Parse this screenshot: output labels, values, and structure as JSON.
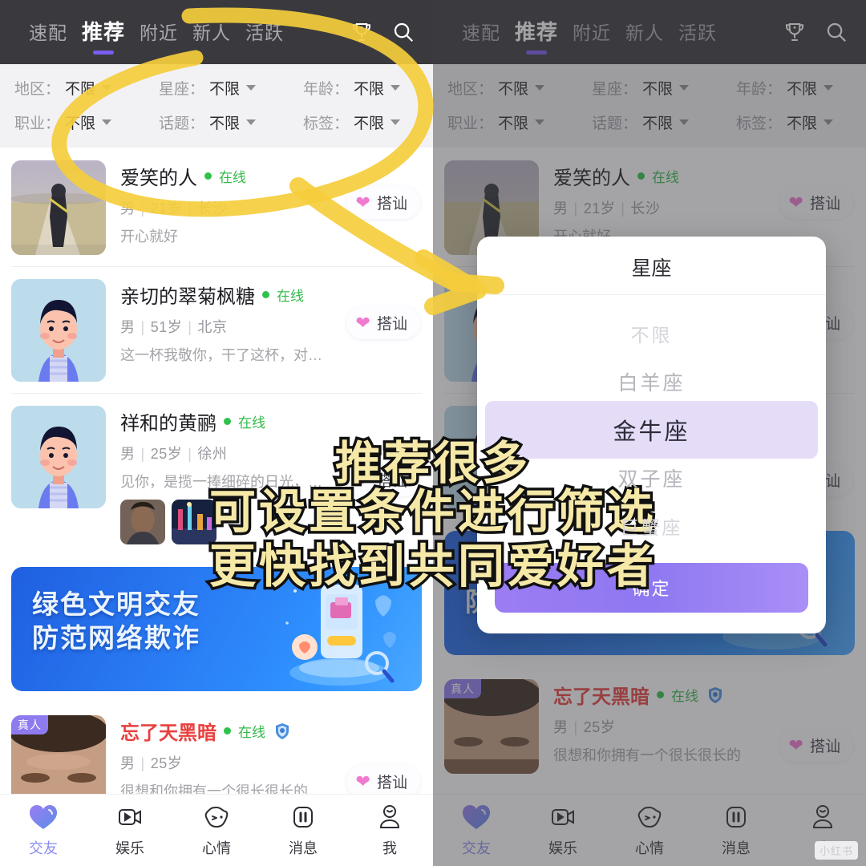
{
  "header": {
    "tabs": [
      {
        "label": "速配",
        "active": false
      },
      {
        "label": "推荐",
        "active": true
      },
      {
        "label": "附近",
        "active": false
      },
      {
        "label": "新人",
        "active": false
      },
      {
        "label": "活跃",
        "active": false
      }
    ],
    "trophy_icon": "trophy-icon",
    "search_icon": "search-icon"
  },
  "filters": {
    "row1": [
      {
        "label": "地区：",
        "value": "不限"
      },
      {
        "label": "星座：",
        "value": "不限"
      },
      {
        "label": "年龄：",
        "value": "不限"
      }
    ],
    "row2": [
      {
        "label": "职业：",
        "value": "不限"
      },
      {
        "label": "话题：",
        "value": "不限"
      },
      {
        "label": "标签：",
        "value": "不限"
      }
    ]
  },
  "feed": {
    "chat_button_label": "搭讪",
    "online_label": "在线",
    "real_badge": "真人",
    "cards": [
      {
        "name": "爱笑的人",
        "gender": "男",
        "age": "21岁",
        "city": "长沙",
        "desc": "开心就好",
        "online": "在线",
        "avatar_type": "photo-road"
      },
      {
        "name": "亲切的翠菊枫糖",
        "gender": "男",
        "age": "51岁",
        "city": "北京",
        "desc": "这一杯我敬你，干了这杯，对…",
        "online": "在线",
        "avatar_type": "cartoon-male"
      },
      {
        "name": "祥和的黄鹂",
        "gender": "男",
        "age": "25岁",
        "city": "徐州",
        "desc": "见你，是揽一捧细碎的日光，…",
        "online": "在线",
        "avatar_type": "cartoon-male",
        "thumbs": [
          "photo-selfie",
          "photo-night-city"
        ]
      },
      {
        "name": "忘了天黑暗",
        "gender": "男",
        "age": "25岁",
        "city": "",
        "desc": "很想和你拥有一个很长很长的",
        "online": "在线",
        "avatar_type": "photo-forehead",
        "name_highlight": true,
        "real_person": true,
        "verified": true
      }
    ]
  },
  "banner": {
    "line1": "绿色文明交友",
    "line2": "防范网络欺诈"
  },
  "tabbar": {
    "items": [
      {
        "label": "交友",
        "icon": "heart-icon",
        "active": true
      },
      {
        "label": "娱乐",
        "icon": "video-icon",
        "active": false
      },
      {
        "label": "心情",
        "icon": "mood-icon",
        "active": false
      },
      {
        "label": "消息",
        "icon": "message-icon",
        "active": false
      },
      {
        "label": "我",
        "icon": "person-icon",
        "active": false
      }
    ]
  },
  "modal": {
    "title": "星座",
    "options": [
      {
        "label": "不限",
        "state": "far"
      },
      {
        "label": "白羊座",
        "state": "near"
      },
      {
        "label": "金牛座",
        "state": "sel"
      },
      {
        "label": "双子座",
        "state": "near"
      },
      {
        "label": "巨蟹座",
        "state": "far"
      }
    ],
    "confirm_label": "确定"
  },
  "annotation": {
    "line1": "推荐很多",
    "line2": "可设置条件进行筛选",
    "line3": "更快找到共同爱好者",
    "marker_color": "#f5cd3c"
  },
  "watermark": "小红书",
  "colors": {
    "accent_purple": "#8a8cf0",
    "online_green": "#35b94b",
    "chat_pink": "#f07ad0",
    "appbar_bg": "#3a3a3e",
    "banner_blue": "#2a7df5",
    "selected_band": "#e5ddf8"
  }
}
